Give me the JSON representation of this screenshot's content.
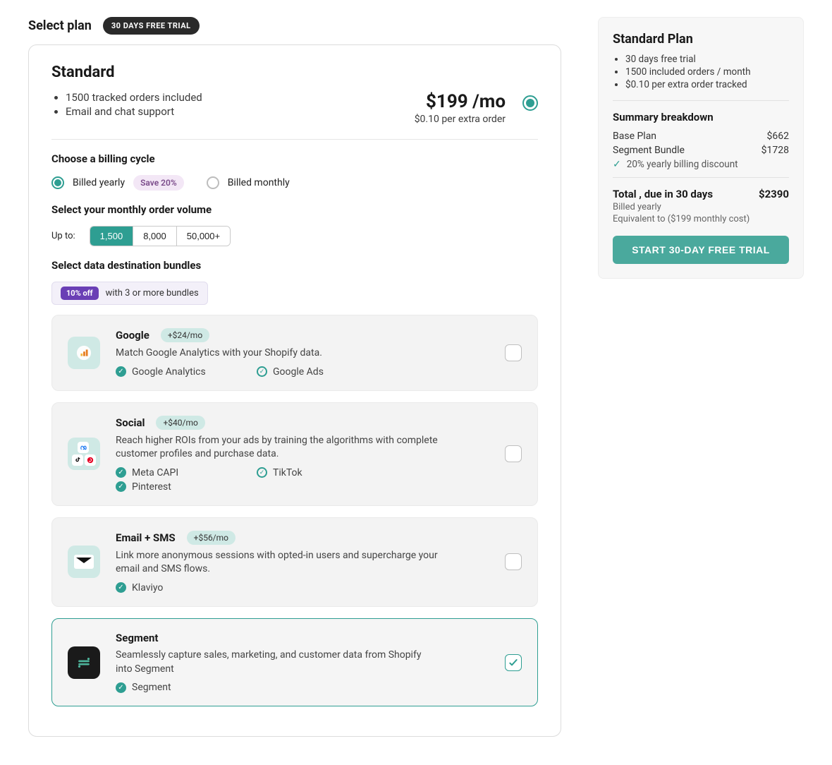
{
  "header": {
    "title": "Select plan",
    "trial_badge": "30 DAYS FREE TRIAL"
  },
  "plan": {
    "name": "Standard",
    "features": [
      "1500 tracked orders included",
      "Email and chat support"
    ],
    "price": "$199 /mo",
    "price_sub": "$0.10 per extra order"
  },
  "cycle": {
    "label": "Choose a billing cycle",
    "yearly_label": "Billed yearly",
    "save_pill": "Save 20%",
    "monthly_label": "Billed monthly"
  },
  "volume": {
    "label": "Select your monthly order volume",
    "upto": "Up to:",
    "options": [
      "1,500",
      "8,000",
      "50,000+"
    ]
  },
  "bundles_section": {
    "label": "Select data destination bundles",
    "off_pill": "10% off",
    "hint": "with 3 or more bundles"
  },
  "bundles": [
    {
      "title": "Google",
      "price": "+$24/mo",
      "desc": "Match Google Analytics with your Shopify data.",
      "tags": [
        {
          "name": "Google Analytics",
          "filled": true
        },
        {
          "name": "Google Ads",
          "filled": false
        }
      ],
      "selected": false,
      "icon": "ga"
    },
    {
      "title": "Social",
      "price": "+$40/mo",
      "desc": "Reach higher ROIs from your ads by training the algorithms with complete customer profiles and purchase data.",
      "tags": [
        {
          "name": "Meta CAPI",
          "filled": true
        },
        {
          "name": "TikTok",
          "filled": false
        },
        {
          "name": "Pinterest",
          "filled": true
        }
      ],
      "selected": false,
      "icon": "social"
    },
    {
      "title": "Email + SMS",
      "price": "+$56/mo",
      "desc": "Link more anonymous sessions with opted-in users and supercharge your email and SMS flows.",
      "tags": [
        {
          "name": "Klaviyo",
          "filled": true
        }
      ],
      "selected": false,
      "icon": "email"
    },
    {
      "title": "Segment",
      "price": "",
      "desc": "Seamlessly capture sales, marketing, and customer data from Shopify into Segment",
      "tags": [
        {
          "name": "Segment",
          "filled": true
        }
      ],
      "selected": true,
      "icon": "segment"
    }
  ],
  "summary": {
    "title": "Standard Plan",
    "bullets": [
      "30 days free trial",
      "1500 included orders / month",
      "$0.10 per extra order tracked"
    ],
    "breakdown_title": "Summary breakdown",
    "lines": [
      {
        "label": "Base Plan",
        "value": "$662"
      },
      {
        "label": "Segment Bundle",
        "value": "$1728"
      }
    ],
    "discount": "20% yearly billing discount",
    "total_label": "Total , due in 30 days",
    "total_value": "$2390",
    "total_sub1": "Billed yearly",
    "total_sub2": "Equivalent to ($199 monthly cost)",
    "button": "START 30-DAY FREE TRIAL"
  }
}
